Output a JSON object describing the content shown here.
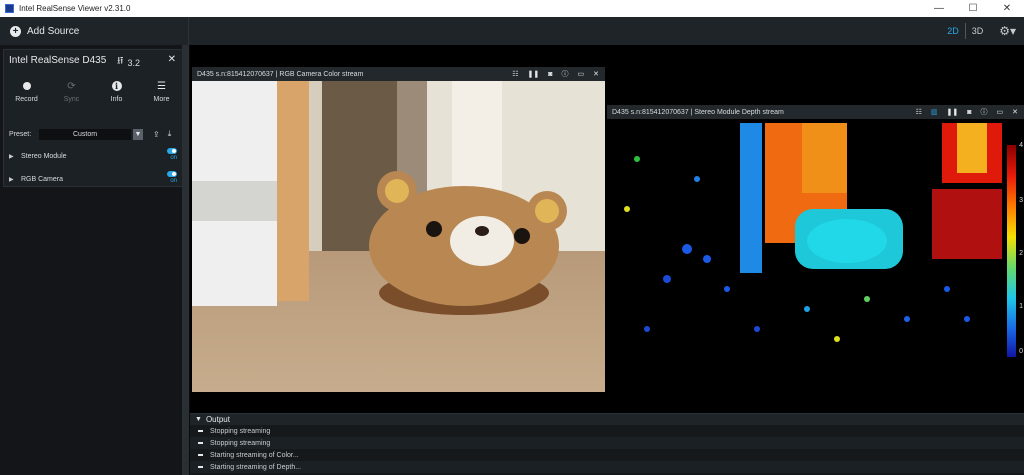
{
  "window": {
    "title": "Intel RealSense Viewer v2.31.0",
    "controls": {
      "minimize": "—",
      "maximize": "☐",
      "close": "✕"
    }
  },
  "toolbar": {
    "add_source": "Add Source",
    "view_2d": "2D",
    "view_3d": "3D",
    "active_view": "2D",
    "accent": "#2ba7e6"
  },
  "device": {
    "name": "Intel RealSense D435",
    "usb": "3.2",
    "actions": [
      {
        "label": "Record",
        "icon": "record-icon"
      },
      {
        "label": "Sync",
        "icon": "sync-icon"
      },
      {
        "label": "Info",
        "icon": "info-icon"
      },
      {
        "label": "More",
        "icon": "menu-icon"
      }
    ],
    "preset_label": "Preset:",
    "preset_value": "Custom",
    "sensors": [
      {
        "name": "Stereo Module",
        "state": "on"
      },
      {
        "name": "RGB Camera",
        "state": "on"
      }
    ]
  },
  "streams": {
    "rgb": {
      "title": "D435 s.n:815412070637 | RGB Camera Color stream"
    },
    "depth": {
      "title": "D435 s.n:815412070637 | Stereo Module Depth stream",
      "legend_ticks": [
        "4",
        "3",
        "2",
        "1",
        "0"
      ]
    }
  },
  "output": {
    "title": "Output",
    "lines": [
      "Stopping streaming",
      "Stopping streaming",
      "Starting streaming of Color...",
      "Starting streaming of Depth..."
    ]
  }
}
